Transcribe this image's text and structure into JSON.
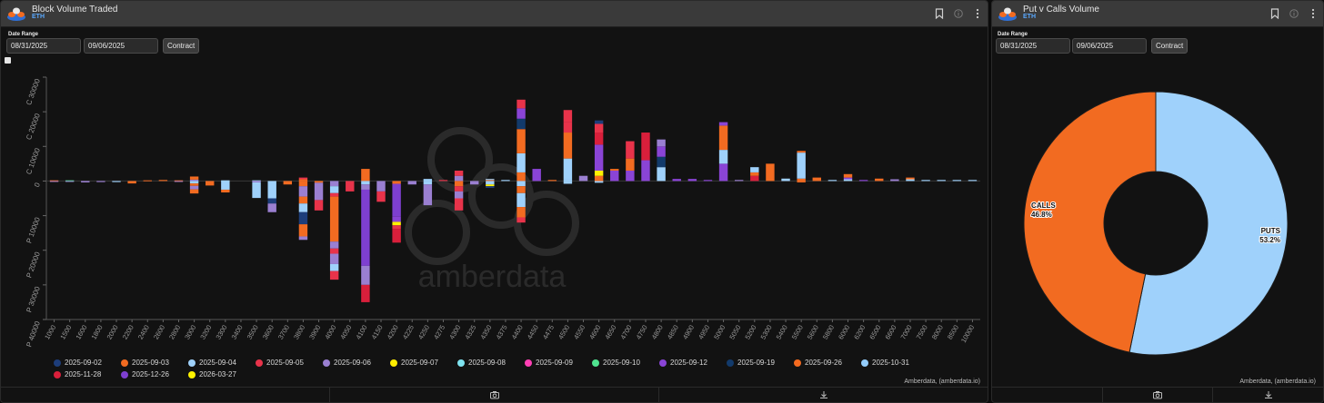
{
  "panel1": {
    "title": "Block Volume Traded",
    "subtitle": "ETH",
    "date_range_label": "Date Range",
    "start_date": "08/31/2025",
    "end_date": "09/06/2025",
    "contract_button": "Contract",
    "credit": "Amberdata, (amberdata.io)",
    "watermark": "amberdata"
  },
  "panel2": {
    "title": "Put v Calls Volume",
    "subtitle": "ETH",
    "date_range_label": "Date Range",
    "start_date": "08/31/2025",
    "end_date": "09/06/2025",
    "contract_button": "Contract",
    "credit": "Amberdata, (amberdata.io)"
  },
  "icons": [
    "bookmark-icon",
    "info-icon",
    "more-icon",
    "camera-icon",
    "download-icon"
  ],
  "chart_data": [
    {
      "type": "bar",
      "stacked": true,
      "ylim": [
        -40000,
        30000
      ],
      "yticks": [
        {
          "value": 30000,
          "label": "C 30000"
        },
        {
          "value": 20000,
          "label": "C 20000"
        },
        {
          "value": 10000,
          "label": "C 10000"
        },
        {
          "value": 0,
          "label": "0"
        },
        {
          "value": -10000,
          "label": "P 10000"
        },
        {
          "value": -20000,
          "label": "P 20000"
        },
        {
          "value": -30000,
          "label": "P 30000"
        },
        {
          "value": -40000,
          "label": "P 40000"
        }
      ],
      "categories": [
        "1000",
        "1500",
        "1600",
        "1800",
        "2000",
        "2200",
        "2400",
        "2600",
        "2800",
        "3000",
        "3200",
        "3300",
        "3400",
        "3500",
        "3600",
        "3700",
        "3800",
        "3900",
        "4000",
        "4050",
        "4100",
        "4150",
        "4200",
        "4225",
        "4250",
        "4275",
        "4300",
        "4325",
        "4350",
        "4375",
        "4400",
        "4450",
        "4475",
        "4500",
        "4550",
        "4600",
        "4650",
        "4700",
        "4750",
        "4800",
        "4850",
        "4900",
        "4950",
        "5000",
        "5050",
        "5200",
        "5300",
        "5400",
        "5500",
        "5600",
        "5800",
        "6000",
        "6200",
        "6500",
        "6600",
        "7000",
        "7500",
        "8000",
        "8500",
        "10000"
      ],
      "legend_placement": "bottom",
      "grid": false,
      "legend": [
        {
          "name": "2025-09-02",
          "color": "#1d3d7a"
        },
        {
          "name": "2025-09-03",
          "color": "#f26b21"
        },
        {
          "name": "2025-09-04",
          "color": "#9fd1fb"
        },
        {
          "name": "2025-09-05",
          "color": "#e8334a"
        },
        {
          "name": "2025-09-06",
          "color": "#9a7fd1"
        },
        {
          "name": "2025-09-07",
          "color": "#ffee00"
        },
        {
          "name": "2025-09-08",
          "color": "#7fe3f0"
        },
        {
          "name": "2025-09-09",
          "color": "#ff3fb4"
        },
        {
          "name": "2025-09-10",
          "color": "#4fe38f"
        },
        {
          "name": "2025-09-12",
          "color": "#8a44d6"
        },
        {
          "name": "2025-09-19",
          "color": "#123a6b"
        },
        {
          "name": "2025-09-26",
          "color": "#f46a1f"
        },
        {
          "name": "2025-10-31",
          "color": "#94cdfb"
        },
        {
          "name": "2025-11-28",
          "color": "#d91f3b"
        },
        {
          "name": "2025-12-26",
          "color": "#7e3fd0"
        },
        {
          "name": "2026-03-27",
          "color": "#fff200"
        }
      ],
      "bars": [
        {
          "x": "1000",
          "segs": [
            [
              200,
              "#f26b21"
            ],
            [
              -200,
              "#9a7fd1"
            ]
          ]
        },
        {
          "x": "1500",
          "segs": [
            [
              200,
              "#4fe38f"
            ],
            [
              -200,
              "#9a7fd1"
            ]
          ]
        },
        {
          "x": "1600",
          "segs": [
            [
              -400,
              "#9a7fd1"
            ]
          ]
        },
        {
          "x": "1800",
          "segs": [
            [
              -300,
              "#9a7fd1"
            ]
          ]
        },
        {
          "x": "2000",
          "segs": [
            [
              -300,
              "#9fd1fb"
            ]
          ]
        },
        {
          "x": "2200",
          "segs": [
            [
              -700,
              "#f26b21"
            ]
          ]
        },
        {
          "x": "2400",
          "segs": [
            [
              200,
              "#f26b21"
            ]
          ]
        },
        {
          "x": "2600",
          "segs": [
            [
              300,
              "#f26b21"
            ]
          ]
        },
        {
          "x": "2800",
          "segs": [
            [
              200,
              "#f26b21"
            ],
            [
              -200,
              "#9a7fd1"
            ]
          ]
        },
        {
          "x": "3000",
          "segs": [
            [
              400,
              "#9a7fd1"
            ],
            [
              900,
              "#f26b21"
            ],
            [
              -700,
              "#9fd1fb"
            ],
            [
              -700,
              "#f26b21"
            ],
            [
              -1000,
              "#9a7fd1"
            ],
            [
              -1200,
              "#f26b21"
            ]
          ]
        },
        {
          "x": "3200",
          "segs": [
            [
              -1300,
              "#f26b21"
            ]
          ]
        },
        {
          "x": "3300",
          "segs": [
            [
              200,
              "#9fd1fb"
            ],
            [
              -2500,
              "#9fd1fb"
            ],
            [
              -800,
              "#f26b21"
            ]
          ]
        },
        {
          "x": "3500",
          "segs": [
            [
              200,
              "#9fd1fb"
            ],
            [
              -400,
              "#9a7fd1"
            ],
            [
              -4500,
              "#9fd1fb"
            ]
          ]
        },
        {
          "x": "3600",
          "segs": [
            [
              -5000,
              "#9fd1fb"
            ],
            [
              -1500,
              "#1d3d7a"
            ],
            [
              -2500,
              "#9a7fd1"
            ]
          ]
        },
        {
          "x": "3700",
          "segs": [
            [
              -1000,
              "#f26b21"
            ]
          ]
        },
        {
          "x": "3800",
          "segs": [
            [
              500,
              "#f26b21"
            ],
            [
              500,
              "#e8334a"
            ],
            [
              -1500,
              "#f26b21"
            ],
            [
              -3000,
              "#9a7fd1"
            ],
            [
              -2000,
              "#f26b21"
            ],
            [
              -2500,
              "#9fd1fb"
            ],
            [
              -3500,
              "#1d3d7a"
            ],
            [
              -3500,
              "#f26b21"
            ],
            [
              -1000,
              "#9a7fd1"
            ]
          ]
        },
        {
          "x": "3900",
          "segs": [
            [
              -500,
              "#f26b21"
            ],
            [
              -5000,
              "#9a7fd1"
            ],
            [
              -3000,
              "#e8334a"
            ]
          ]
        },
        {
          "x": "4000",
          "segs": [
            [
              -1500,
              "#9a7fd1"
            ],
            [
              -2000,
              "#9fd1fb"
            ],
            [
              -1000,
              "#e8334a"
            ],
            [
              -13000,
              "#f26b21"
            ],
            [
              -2000,
              "#9a7fd1"
            ],
            [
              -1500,
              "#e8334a"
            ],
            [
              -3000,
              "#9a7fd1"
            ],
            [
              -2000,
              "#9fd1fb"
            ],
            [
              -2500,
              "#e8334a"
            ]
          ]
        },
        {
          "x": "4050",
          "segs": [
            [
              -3000,
              "#e8334a"
            ]
          ]
        },
        {
          "x": "4100",
          "segs": [
            [
              3500,
              "#f26b21"
            ],
            [
              -1000,
              "#9fd1fb"
            ],
            [
              -1500,
              "#9a7fd1"
            ],
            [
              -22000,
              "#7e3fd0"
            ],
            [
              -5500,
              "#9a7fd1"
            ],
            [
              -5000,
              "#d91f3b"
            ]
          ]
        },
        {
          "x": "4150",
          "segs": [
            [
              -3000,
              "#9a7fd1"
            ],
            [
              -3000,
              "#e8334a"
            ]
          ]
        },
        {
          "x": "4200",
          "segs": [
            [
              -800,
              "#f26b21"
            ],
            [
              -9500,
              "#7e3fd0"
            ],
            [
              -1500,
              "#8a44d6"
            ],
            [
              -1000,
              "#fff200"
            ],
            [
              -1000,
              "#e8334a"
            ],
            [
              -4000,
              "#d91f3b"
            ]
          ]
        },
        {
          "x": "4225",
          "segs": [
            [
              -1000,
              "#9a7fd1"
            ]
          ]
        },
        {
          "x": "4250",
          "segs": [
            [
              600,
              "#9fd1fb"
            ],
            [
              -1000,
              "#9fd1fb"
            ],
            [
              -6000,
              "#9a7fd1"
            ]
          ]
        },
        {
          "x": "4275",
          "segs": [
            [
              300,
              "#e8334a"
            ]
          ]
        },
        {
          "x": "4300",
          "segs": [
            [
              1500,
              "#9a7fd1"
            ],
            [
              1500,
              "#e8334a"
            ],
            [
              -1500,
              "#f26b21"
            ],
            [
              -1500,
              "#e8334a"
            ],
            [
              -2000,
              "#9a7fd1"
            ],
            [
              -3500,
              "#e8334a"
            ]
          ]
        },
        {
          "x": "4325",
          "segs": [
            [
              -1000,
              "#9a7fd1"
            ]
          ]
        },
        {
          "x": "4350",
          "segs": [
            [
              300,
              "#f26b21"
            ],
            [
              300,
              "#9fd1fb"
            ],
            [
              -1000,
              "#9fd1fb"
            ],
            [
              -500,
              "#fff200"
            ],
            [
              -500,
              "#1d3d7a"
            ]
          ]
        },
        {
          "x": "4375",
          "segs": [
            [
              300,
              "#9fd1fb"
            ]
          ]
        },
        {
          "x": "4400",
          "segs": [
            [
              2500,
              "#f26b21"
            ],
            [
              5500,
              "#9fd1fb"
            ],
            [
              7000,
              "#f26b21"
            ],
            [
              3000,
              "#123a6b"
            ],
            [
              3000,
              "#8a44d6"
            ],
            [
              2500,
              "#e8334a"
            ],
            [
              -1500,
              "#9fd1fb"
            ],
            [
              -2000,
              "#f26b21"
            ],
            [
              -4000,
              "#9fd1fb"
            ],
            [
              -3000,
              "#f26b21"
            ],
            [
              -1500,
              "#e8334a"
            ]
          ]
        },
        {
          "x": "4450",
          "segs": [
            [
              3500,
              "#8a44d6"
            ]
          ]
        },
        {
          "x": "4475",
          "segs": [
            [
              300,
              "#f26b21"
            ]
          ]
        },
        {
          "x": "4500",
          "segs": [
            [
              -800,
              "#9fd1fb"
            ],
            [
              500,
              "#9fd1fb"
            ],
            [
              6000,
              "#9fd1fb"
            ],
            [
              7500,
              "#f26b21"
            ],
            [
              3000,
              "#e8334a"
            ],
            [
              3500,
              "#e8334a"
            ]
          ]
        },
        {
          "x": "4550",
          "segs": [
            [
              1500,
              "#9a7fd1"
            ]
          ]
        },
        {
          "x": "4600",
          "segs": [
            [
              -500,
              "#9fd1fb"
            ],
            [
              1500,
              "#f26b21"
            ],
            [
              1500,
              "#fff200"
            ],
            [
              7500,
              "#8a44d6"
            ],
            [
              3500,
              "#d91f3b"
            ],
            [
              2500,
              "#e8334a"
            ],
            [
              1000,
              "#1d3d7a"
            ]
          ]
        },
        {
          "x": "4650",
          "segs": [
            [
              3000,
              "#8a44d6"
            ],
            [
              500,
              "#f26b21"
            ]
          ]
        },
        {
          "x": "4700",
          "segs": [
            [
              3000,
              "#8a44d6"
            ],
            [
              3500,
              "#f26b21"
            ],
            [
              5000,
              "#e8334a"
            ]
          ]
        },
        {
          "x": "4750",
          "segs": [
            [
              6000,
              "#8a44d6"
            ],
            [
              8000,
              "#d91f3b"
            ]
          ]
        },
        {
          "x": "4800",
          "segs": [
            [
              4000,
              "#9fd1fb"
            ],
            [
              3000,
              "#123a6b"
            ],
            [
              3000,
              "#8a44d6"
            ],
            [
              2000,
              "#9a7fd1"
            ]
          ]
        },
        {
          "x": "4850",
          "segs": [
            [
              600,
              "#8a44d6"
            ]
          ]
        },
        {
          "x": "4900",
          "segs": [
            [
              600,
              "#8a44d6"
            ]
          ]
        },
        {
          "x": "4950",
          "segs": [
            [
              300,
              "#8a44d6"
            ]
          ]
        },
        {
          "x": "5000",
          "segs": [
            [
              5000,
              "#8a44d6"
            ],
            [
              4000,
              "#9fd1fb"
            ],
            [
              7000,
              "#f26b21"
            ],
            [
              1000,
              "#8a44d6"
            ]
          ]
        },
        {
          "x": "5050",
          "segs": [
            [
              300,
              "#9a7fd1"
            ]
          ]
        },
        {
          "x": "5200",
          "segs": [
            [
              1500,
              "#d91f3b"
            ],
            [
              1000,
              "#f26b21"
            ],
            [
              1500,
              "#9fd1fb"
            ]
          ]
        },
        {
          "x": "5300",
          "segs": [
            [
              5000,
              "#f26b21"
            ]
          ]
        },
        {
          "x": "5400",
          "segs": [
            [
              700,
              "#9fd1fb"
            ]
          ]
        },
        {
          "x": "5500",
          "segs": [
            [
              -400,
              "#f26b21"
            ],
            [
              700,
              "#f26b21"
            ],
            [
              7500,
              "#9fd1fb"
            ],
            [
              500,
              "#f26b21"
            ]
          ]
        },
        {
          "x": "5600",
          "segs": [
            [
              1000,
              "#f26b21"
            ]
          ]
        },
        {
          "x": "5800",
          "segs": [
            [
              300,
              "#9fd1fb"
            ]
          ]
        },
        {
          "x": "6000",
          "segs": [
            [
              500,
              "#9fd1fb"
            ],
            [
              500,
              "#8a44d6"
            ],
            [
              1000,
              "#f26b21"
            ]
          ]
        },
        {
          "x": "6200",
          "segs": [
            [
              300,
              "#8a44d6"
            ]
          ]
        },
        {
          "x": "6500",
          "segs": [
            [
              700,
              "#f26b21"
            ]
          ]
        },
        {
          "x": "6600",
          "segs": [
            [
              500,
              "#9a7fd1"
            ]
          ]
        },
        {
          "x": "7000",
          "segs": [
            [
              500,
              "#9fd1fb"
            ],
            [
              500,
              "#f26b21"
            ]
          ]
        },
        {
          "x": "7500",
          "segs": [
            [
              300,
              "#9fd1fb"
            ]
          ]
        },
        {
          "x": "8000",
          "segs": [
            [
              300,
              "#9fd1fb"
            ]
          ]
        },
        {
          "x": "8500",
          "segs": [
            [
              300,
              "#9fd1fb"
            ]
          ]
        },
        {
          "x": "10000",
          "segs": [
            [
              300,
              "#9fd1fb"
            ]
          ]
        }
      ]
    },
    {
      "type": "pie",
      "donut": true,
      "slices": [
        {
          "name": "PUTS",
          "value": 53.2,
          "label": "53.2%",
          "color": "#9fd1fb"
        },
        {
          "name": "CALLS",
          "value": 46.8,
          "label": "46.8%",
          "color": "#f26b21"
        }
      ]
    }
  ]
}
